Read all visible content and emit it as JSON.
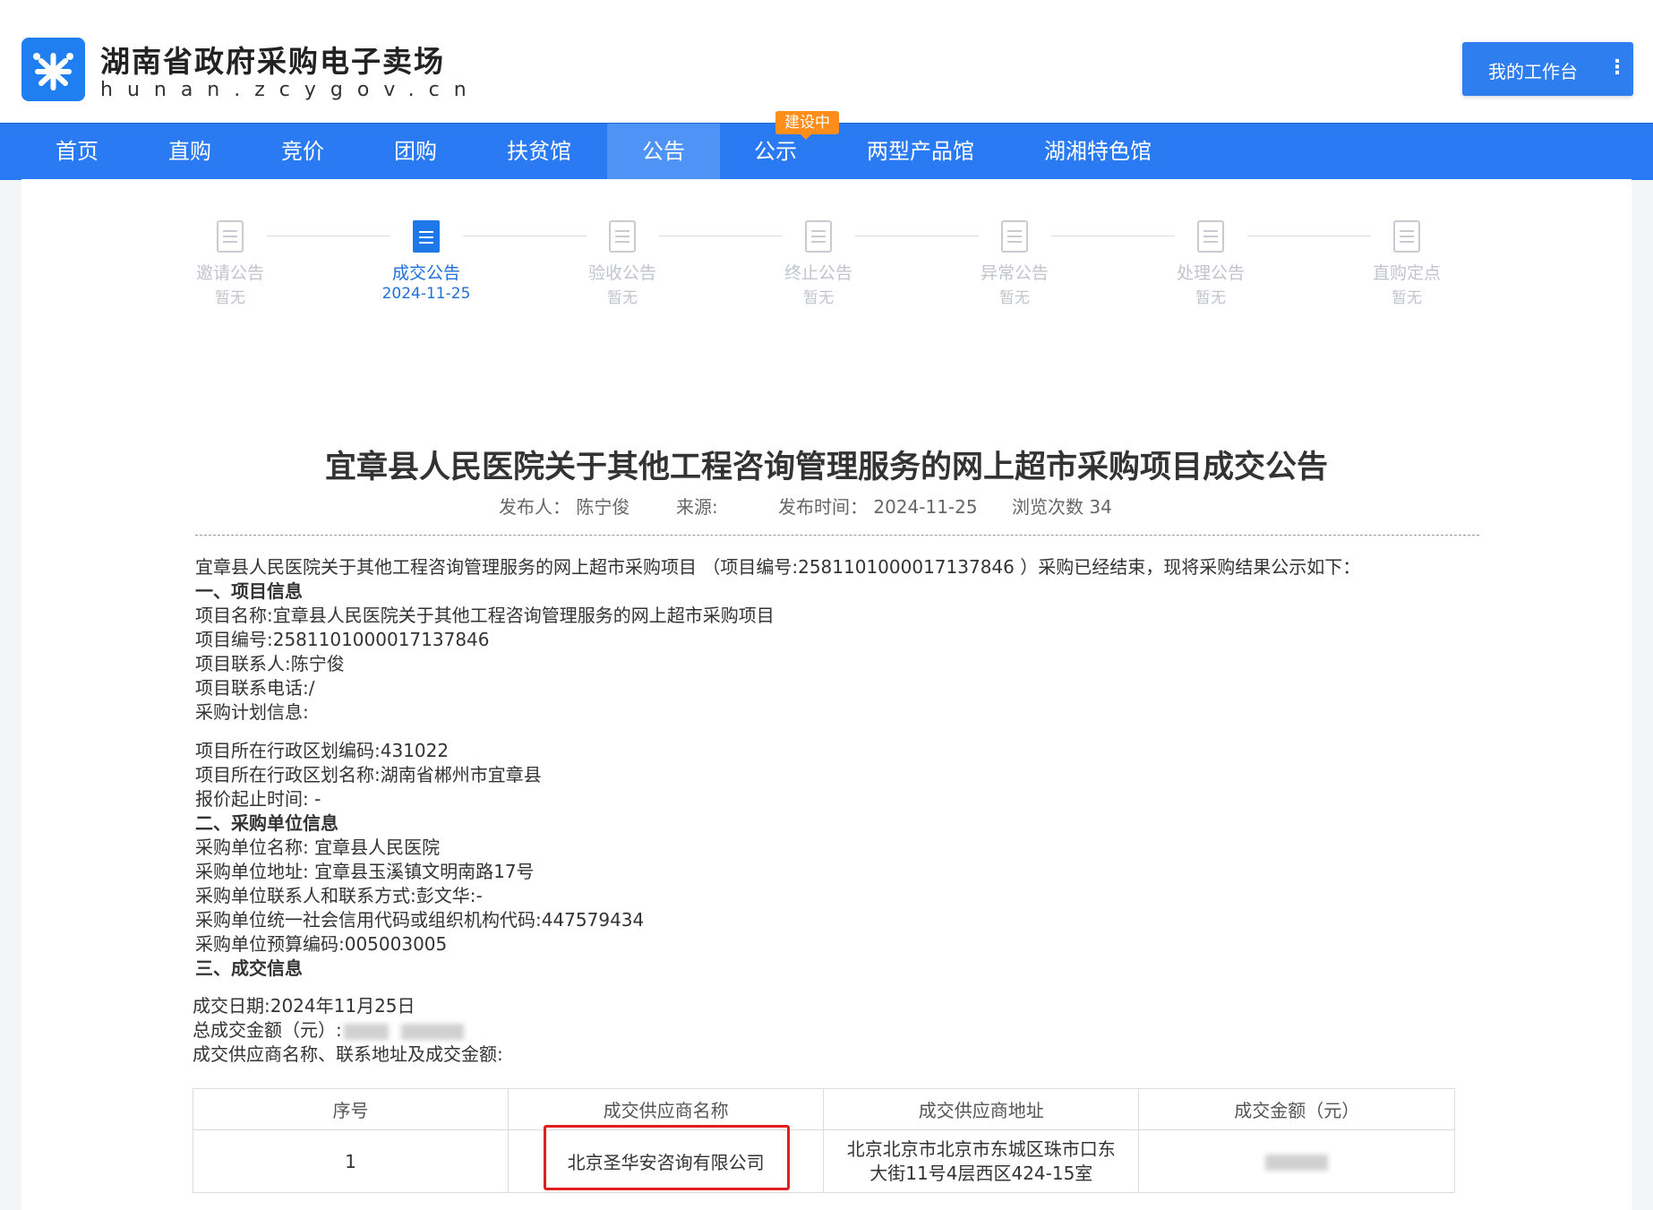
{
  "header": {
    "site_title": "湖南省政府采购电子卖场",
    "site_domain": "hunan.zcygov.cn",
    "workbench_label": "我的工作台",
    "workbench_menu_icon": "⋮",
    "logo_icon": "logo-star-icon"
  },
  "nav": {
    "items": [
      {
        "label": "首页"
      },
      {
        "label": "直购"
      },
      {
        "label": "竞价"
      },
      {
        "label": "团购"
      },
      {
        "label": "扶贫馆"
      },
      {
        "label": "公告"
      },
      {
        "label": "公示"
      },
      {
        "label": "两型产品馆"
      },
      {
        "label": "湖湘特色馆"
      }
    ],
    "active": "公告",
    "badge": "建设中"
  },
  "steps": [
    {
      "name": "邀请公告",
      "sub": "暂无"
    },
    {
      "name": "成交公告",
      "sub": "2024-11-25"
    },
    {
      "name": "验收公告",
      "sub": "暂无"
    },
    {
      "name": "终止公告",
      "sub": "暂无"
    },
    {
      "name": "异常公告",
      "sub": "暂无"
    },
    {
      "name": "处理公告",
      "sub": "暂无"
    },
    {
      "name": "直购定点",
      "sub": "暂无"
    }
  ],
  "document": {
    "title": "宜章县人民医院关于其他工程咨询管理服务的网上超市采购项目成交公告",
    "meta": {
      "publisher": "发布人：  陈宁俊",
      "source": "来源:",
      "publish_time": "发布时间：  2024-11-25",
      "views": "浏览次数 34"
    },
    "intro": "宜章县人民医院关于其他工程咨询管理服务的网上超市采购项目 （项目编号:2581101000017137846 ）采购已经结束，现将采购结果公示如下：",
    "section1": {
      "heading": "一、项目信息",
      "lines": [
        "项目名称:宜章县人民医院关于其他工程咨询管理服务的网上超市采购项目",
        "项目编号:2581101000017137846",
        "项目联系人:陈宁俊",
        "项目联系电话:/",
        "采购计划信息:"
      ],
      "lines_after_gap": [
        "项目所在行政区划编码:431022",
        "项目所在行政区划名称:湖南省郴州市宜章县",
        "报价起止时间: -"
      ]
    },
    "section2": {
      "heading": "二、采购单位信息",
      "lines": [
        "采购单位名称: 宜章县人民医院",
        "采购单位地址: 宜章县玉溪镇文明南路17号",
        "采购单位联系人和联系方式:彭文华:-",
        "采购单位统一社会信用代码或组织机构代码:447579434",
        "采购单位预算编码:005003005"
      ]
    },
    "section3": {
      "heading": "三、成交信息",
      "deal_date": "成交日期:2024年11月25日",
      "total_amount_label": "总成交金额（元）:",
      "supplier_label": "成交供应商名称、联系地址及成交金额:"
    }
  },
  "table": {
    "headers": [
      "序号",
      "成交供应商名称",
      "成交供应商地址",
      "成交金额（元）"
    ],
    "rows": [
      {
        "index": "1",
        "supplier": "北京圣华安咨询有限公司",
        "address_line1": "北京北京市北京市东城区珠市口东",
        "address_line2": "大街11号4层西区424-15室"
      }
    ]
  },
  "colors": {
    "nav_bg": "#2a7bf3",
    "nav_active": "#4f93f7",
    "badge": "#ff8d1a",
    "step_active": "#1f6fdb",
    "highlight": "#e02020"
  }
}
